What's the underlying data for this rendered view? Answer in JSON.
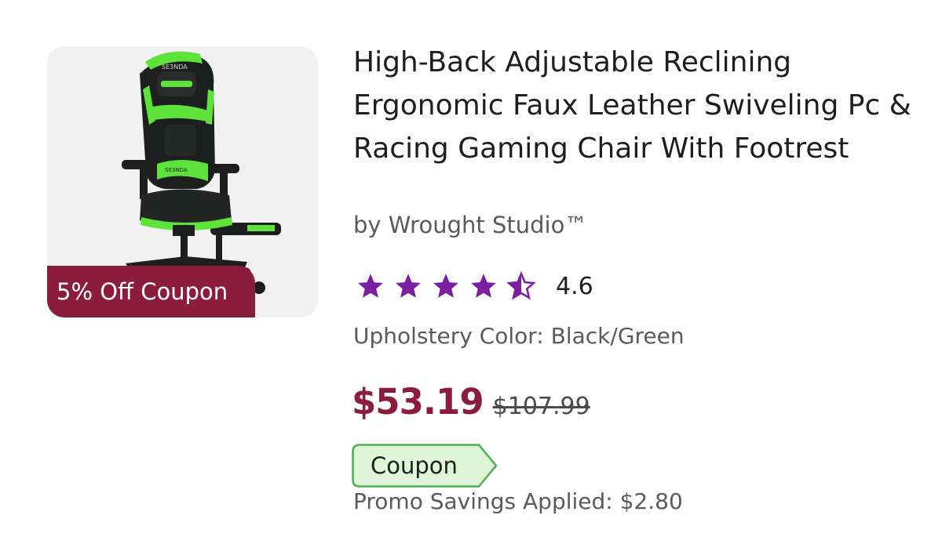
{
  "product": {
    "title": "High-Back Adjustable Reclining Ergonomic Faux Leather Swiveling Pc & Racing Gaming Chair With Footrest",
    "brand": "by Wrought Studio™",
    "rating": 4.6,
    "rating_text": "4.6",
    "rating_max": 5,
    "option_text": "Upholstery Color: Black/Green",
    "sale_price": "$53.19",
    "list_price": "$107.99",
    "coupon_tag": "Coupon",
    "promo_text": "Promo Savings Applied: $2.80",
    "image": {
      "badge": "5% Off Coupon",
      "logo_text": "SE3NDA"
    }
  },
  "colors": {
    "sale": "#8c1c3c",
    "badge_bg": "#8c1c3c",
    "star": "#7b1fa2",
    "coupon_bg": "#dff5d8",
    "coupon_border": "#4caf50",
    "chair_green": "#5ee33a",
    "chair_black": "#1d1f1e"
  }
}
